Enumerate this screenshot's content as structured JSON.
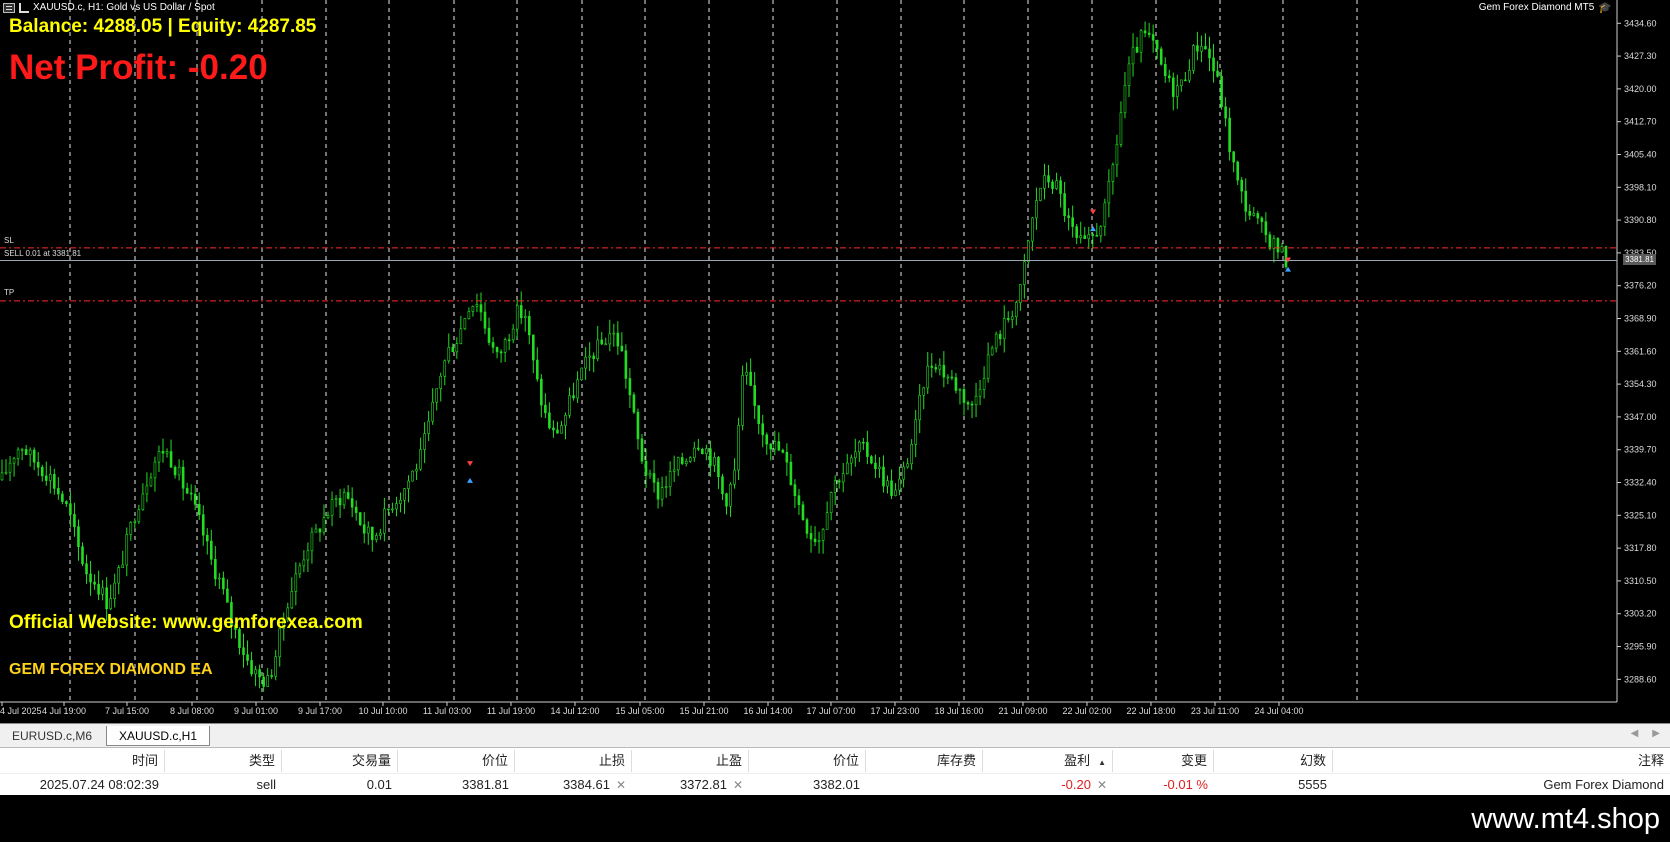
{
  "window": {
    "title": "XAUUSD.c, H1:  Gold vs US Dollar / Spot",
    "ea_badge": "Gem Forex Diamond MT5"
  },
  "overlay": {
    "balance_line": "Balance: 4288.05 | Equity: 4287.85",
    "net_profit": "Net Profit: -0.20",
    "website": "Official Website: www.gemforexea.com",
    "ea_name": "GEM FOREX DIAMOND EA"
  },
  "trade_lines": {
    "sl_label": "SL",
    "sell_label": "SELL 0.01 at 3381.81",
    "tp_label": "TP",
    "sl_price": 3384.61,
    "entry_price": 3381.81,
    "tp_price": 3372.81,
    "bid_tag": "3381.81"
  },
  "chart_data": {
    "type": "candlestick",
    "symbol": "XAUUSD.c",
    "timeframe": "H1",
    "y_ticks": [
      "3434.60",
      "3427.30",
      "3420.00",
      "3412.70",
      "3405.40",
      "3398.10",
      "3390.80",
      "3383.50",
      "3376.20",
      "3368.90",
      "3361.60",
      "3354.30",
      "3347.00",
      "3339.70",
      "3332.40",
      "3325.10",
      "3317.80",
      "3310.50",
      "3303.20",
      "3295.90",
      "3288.60"
    ],
    "ylim": [
      3284.0,
      3438.0
    ],
    "x_ticks": [
      "4 Jul 2025",
      "4 Jul 19:00",
      "7 Jul 15:00",
      "8 Jul 08:00",
      "9 Jul 01:00",
      "9 Jul 17:00",
      "10 Jul 10:00",
      "11 Jul 03:00",
      "11 Jul 19:00",
      "14 Jul 12:00",
      "15 Jul 05:00",
      "15 Jul 21:00",
      "16 Jul 14:00",
      "17 Jul 07:00",
      "17 Jul 23:00",
      "18 Jul 16:00",
      "21 Jul 09:00",
      "22 Jul 02:00",
      "22 Jul 18:00",
      "23 Jul 11:00",
      "24 Jul 04:00"
    ],
    "close_path": [
      3333,
      3338,
      3341,
      3338,
      3336,
      3334,
      3330,
      3326,
      3318,
      3312,
      3310,
      3306,
      3310,
      3318,
      3326,
      3332,
      3337,
      3340,
      3337,
      3332,
      3328,
      3322,
      3315,
      3310,
      3302,
      3297,
      3292,
      3289,
      3288,
      3296,
      3306,
      3312,
      3318,
      3321,
      3325,
      3328,
      3330,
      3327,
      3322,
      3320,
      3324,
      3328,
      3330,
      3334,
      3338,
      3346,
      3356,
      3362,
      3365,
      3372,
      3373,
      3366,
      3360,
      3364,
      3370,
      3370,
      3357,
      3348,
      3343,
      3346,
      3352,
      3357,
      3361,
      3363,
      3366,
      3363,
      3352,
      3340,
      3333,
      3330,
      3333,
      3336,
      3338,
      3342,
      3340,
      3336,
      3328,
      3334,
      3358,
      3350,
      3344,
      3341,
      3339,
      3333,
      3326,
      3321,
      3320,
      3330,
      3334,
      3336,
      3340,
      3339,
      3336,
      3332,
      3330,
      3336,
      3344,
      3356,
      3360,
      3357,
      3355,
      3352,
      3349,
      3356,
      3362,
      3366,
      3370,
      3374,
      3387,
      3398,
      3400,
      3398,
      3391,
      3386,
      3385,
      3388,
      3393,
      3405,
      3420,
      3428,
      3432,
      3430,
      3424,
      3420,
      3421,
      3427,
      3431,
      3427,
      3420,
      3408,
      3398,
      3393,
      3390,
      3387,
      3385,
      3382
    ]
  },
  "tabs": [
    {
      "label": "EURUSD.c,M6"
    },
    {
      "label": "XAUUSD.c,H1"
    }
  ],
  "table": {
    "headers": {
      "time": "时间",
      "type": "类型",
      "volume": "交易量",
      "price": "价位",
      "sl": "止损",
      "tp": "止盈",
      "current": "价位",
      "swap": "库存费",
      "profit": "盈利",
      "change": "变更",
      "magic": "幻数",
      "comment": "注释"
    },
    "row": {
      "time": "2025.07.24 08:02:39",
      "type": "sell",
      "volume": "0.01",
      "price": "3381.81",
      "sl": "3384.61",
      "tp": "3372.81",
      "current": "3382.01",
      "swap": "",
      "profit": "-0.20",
      "change": "-0.01 %",
      "magic": "5555",
      "comment": "Gem Forex Diamond"
    },
    "close_symbol": "✕",
    "sort_symbol": "▲"
  },
  "footer": {
    "watermark": "www.mt4.shop"
  }
}
